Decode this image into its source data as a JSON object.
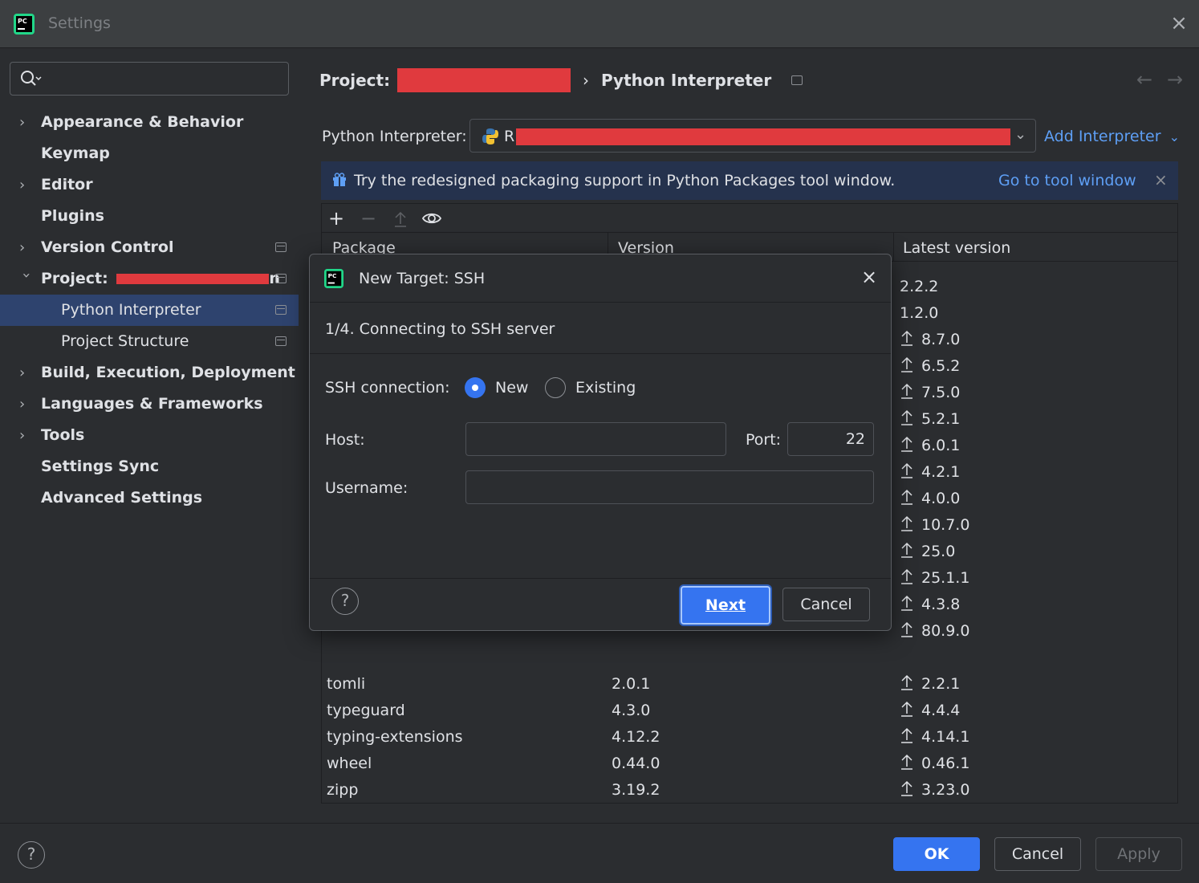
{
  "window": {
    "title": "Settings"
  },
  "search": {
    "placeholder": ""
  },
  "sidebar": {
    "items": [
      {
        "label": "Appearance & Behavior"
      },
      {
        "label": "Keymap"
      },
      {
        "label": "Editor"
      },
      {
        "label": "Plugins"
      },
      {
        "label": "Version Control"
      },
      {
        "label": "Project:"
      },
      {
        "label": "Python Interpreter"
      },
      {
        "label": "Project Structure"
      },
      {
        "label": "Build, Execution, Deployment"
      },
      {
        "label": "Languages & Frameworks"
      },
      {
        "label": "Tools"
      },
      {
        "label": "Settings Sync"
      },
      {
        "label": "Advanced Settings"
      }
    ],
    "project_suffix": "n"
  },
  "breadcrumb": {
    "project": "Project:",
    "separator": "›",
    "current": "Python Interpreter"
  },
  "interpreter": {
    "label": "Python Interpreter:",
    "value_prefix": "R",
    "add_label": "Add Interpreter"
  },
  "banner": {
    "message": "Try the redesigned packaging support in Python Packages tool window.",
    "link": "Go to tool window"
  },
  "table": {
    "headers": [
      "Package",
      "Version",
      "Latest version"
    ],
    "latest_only": [
      {
        "latest": "2.2.2",
        "upgrade": false
      },
      {
        "latest": "1.2.0",
        "upgrade": false
      },
      {
        "latest": "8.7.0",
        "upgrade": true
      },
      {
        "latest": "6.5.2",
        "upgrade": true
      },
      {
        "latest": "7.5.0",
        "upgrade": true
      },
      {
        "latest": "5.2.1",
        "upgrade": true
      },
      {
        "latest": "6.0.1",
        "upgrade": true
      },
      {
        "latest": "4.2.1",
        "upgrade": true
      },
      {
        "latest": "4.0.0",
        "upgrade": true
      },
      {
        "latest": "10.7.0",
        "upgrade": true
      },
      {
        "latest": "25.0",
        "upgrade": true
      },
      {
        "latest": "25.1.1",
        "upgrade": true
      },
      {
        "latest": "4.3.8",
        "upgrade": true
      },
      {
        "latest": "80.9.0",
        "upgrade": true
      }
    ],
    "rows": [
      {
        "package": "tomli",
        "version": "2.0.1",
        "latest": "2.2.1"
      },
      {
        "package": "typeguard",
        "version": "4.3.0",
        "latest": "4.4.4"
      },
      {
        "package": "typing-extensions",
        "version": "4.12.2",
        "latest": "4.14.1"
      },
      {
        "package": "wheel",
        "version": "0.44.0",
        "latest": "0.46.1"
      },
      {
        "package": "zipp",
        "version": "3.19.2",
        "latest": "3.23.0"
      }
    ]
  },
  "dialog": {
    "title": "New Target: SSH",
    "step": "1/4. Connecting to SSH server",
    "ssh_label": "SSH connection:",
    "option_new": "New",
    "option_existing": "Existing",
    "selected_option": "New",
    "host_label": "Host:",
    "host_value": "",
    "port_label": "Port:",
    "port_value": "22",
    "username_label": "Username:",
    "username_value": "",
    "next_label": "Next",
    "cancel_label": "Cancel"
  },
  "footer": {
    "ok_label": "OK",
    "cancel_label": "Cancel",
    "apply_label": "Apply"
  },
  "colors": {
    "accent": "#3574f0",
    "selection": "#2e436e",
    "link": "#5e9ff5",
    "banner": "#25324d",
    "redaction": "#e03a3e"
  }
}
